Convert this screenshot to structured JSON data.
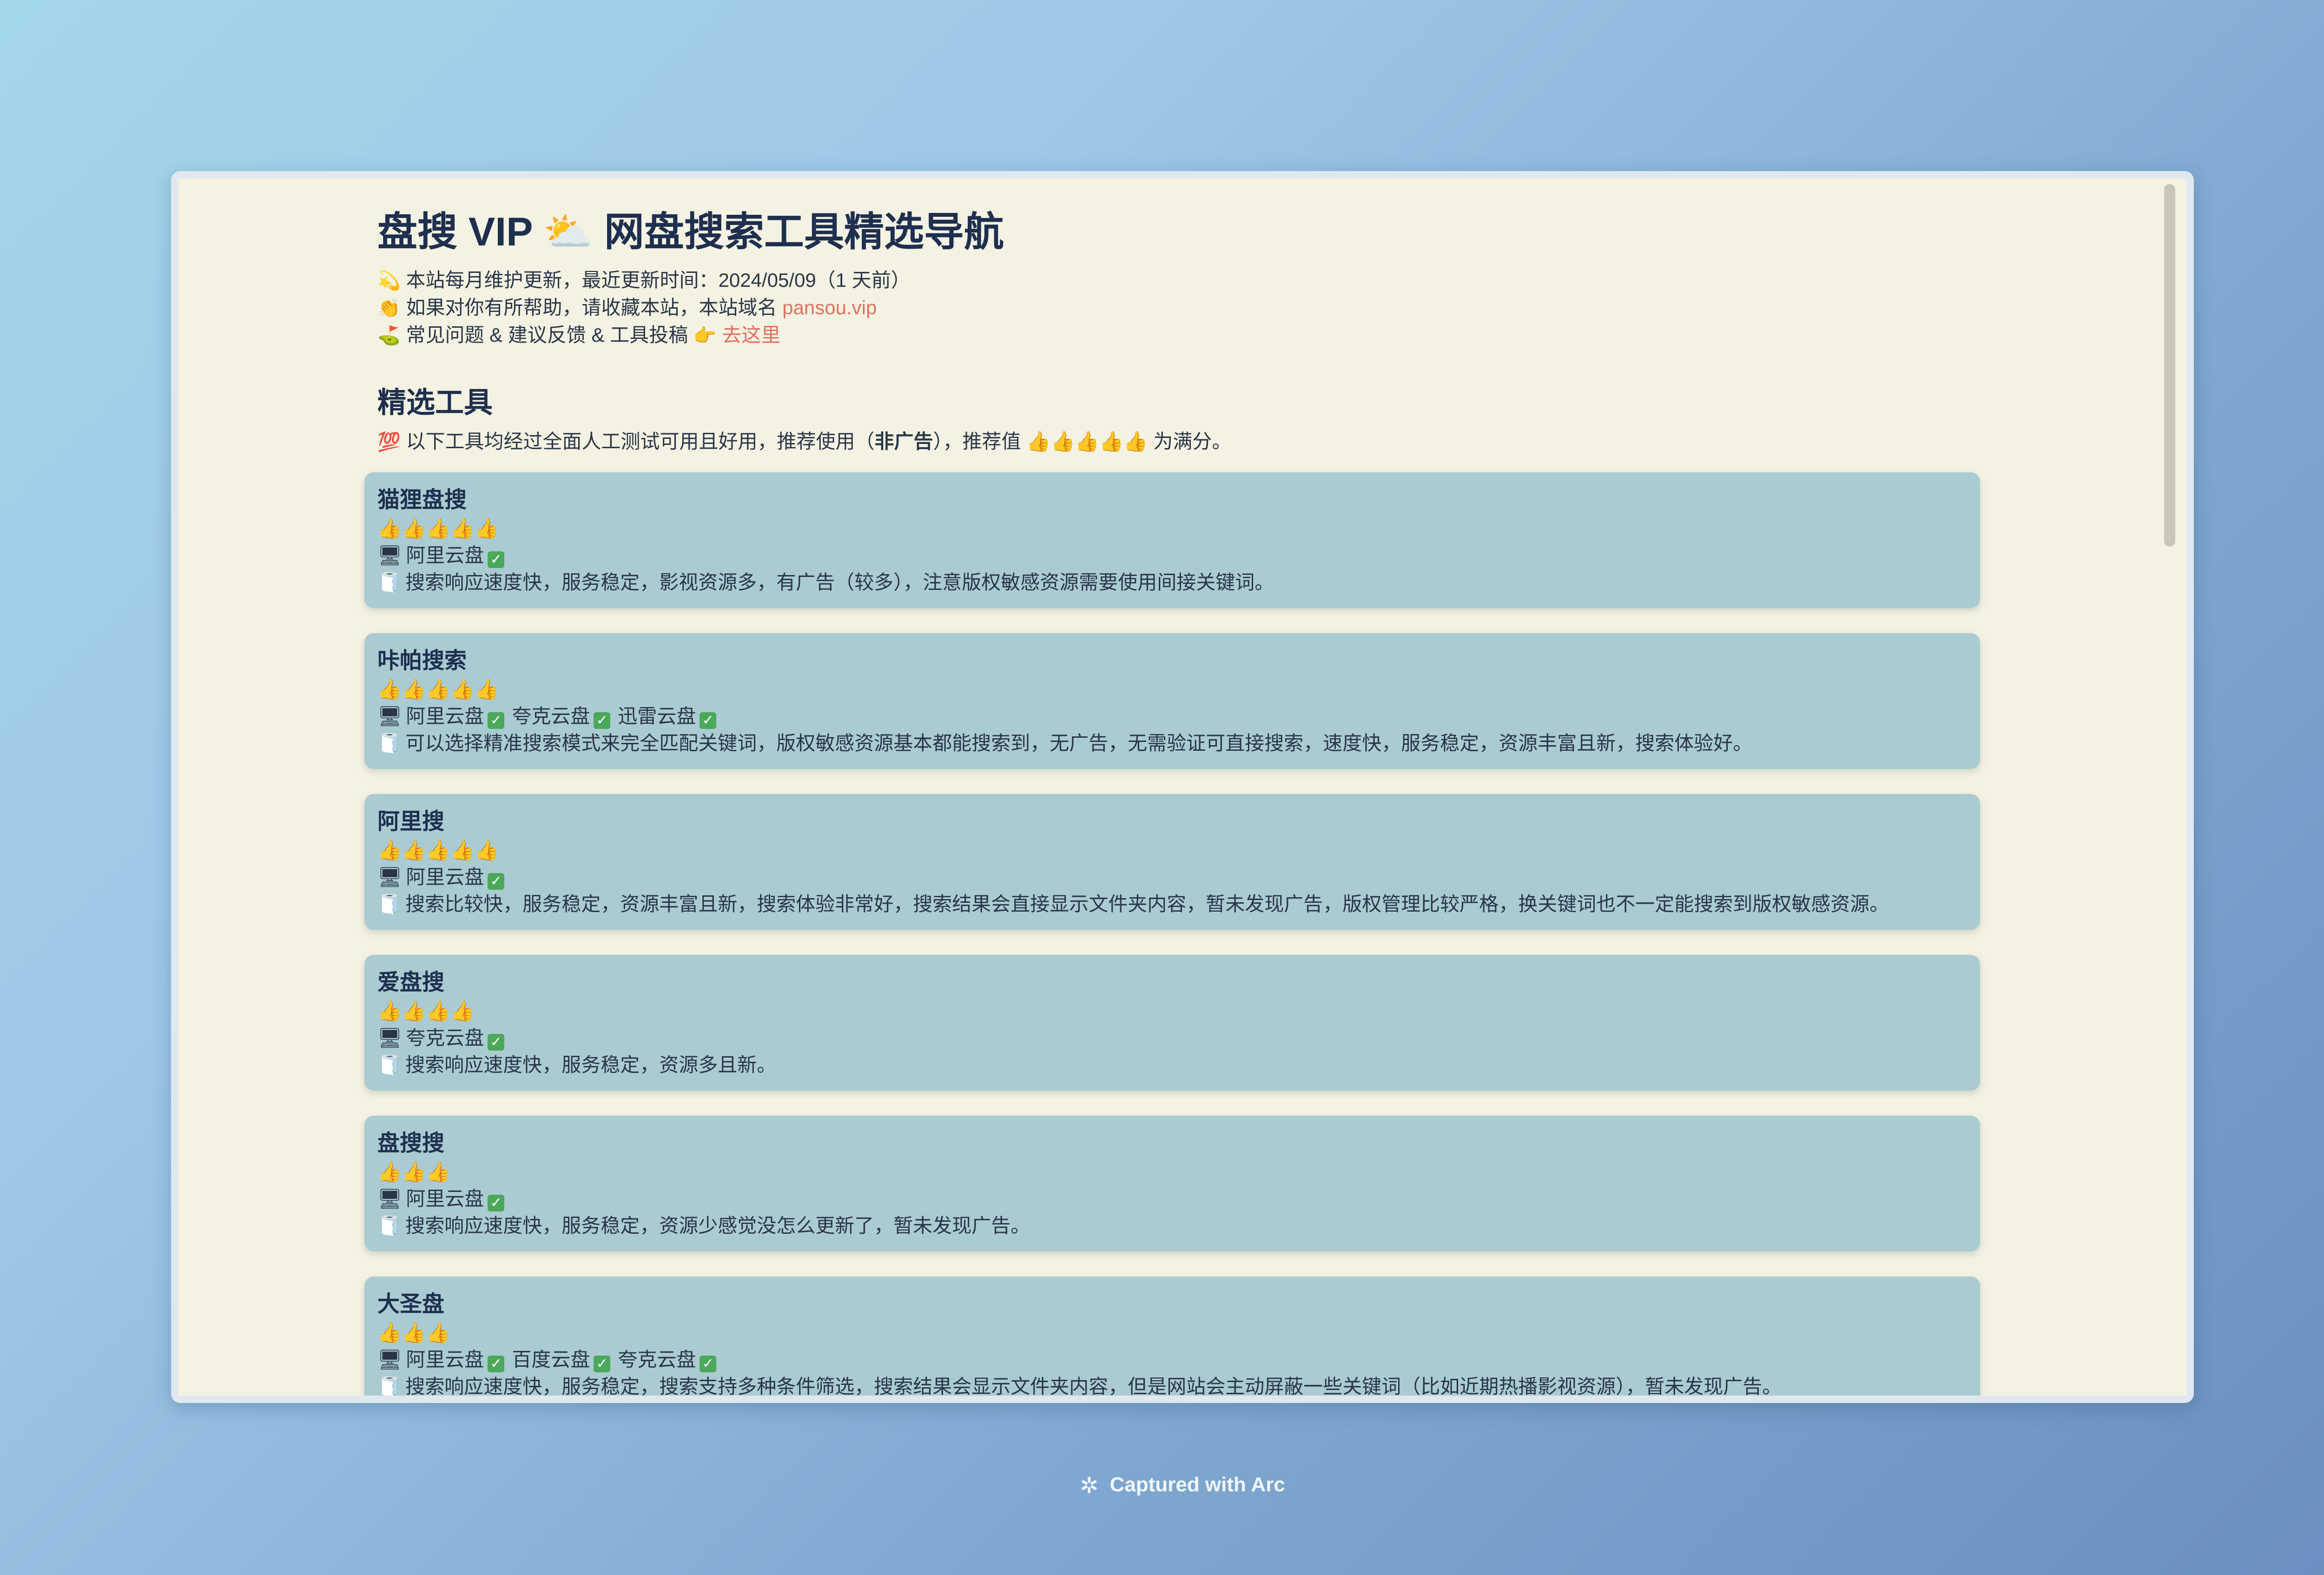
{
  "header": {
    "title": "盘搜 VIP ⛅ 网盘搜索工具精选导航",
    "line1_emoji": "💫",
    "line1": "本站每月维护更新，最近更新时间：2024/05/09（1 天前）",
    "line2_emoji": "👏",
    "line2": "如果对你有所帮助，请收藏本站，本站域名",
    "line2_link": "pansou.vip",
    "line3_emoji": "⛳",
    "line3": "常见问题 & 建议反馈 & 工具投稿",
    "line3_pointer": "👉",
    "line3_link": "去这里"
  },
  "section": {
    "title": "精选工具",
    "note_emoji": "💯",
    "note_pre": "以下工具均经过全面人工测试可用且好用，推荐使用（",
    "note_bold": "非广告",
    "note_post": "），推荐值 👍👍👍👍👍 为满分。"
  },
  "tools": [
    {
      "name": "猫狸盘搜",
      "rating": "👍👍👍👍👍",
      "drives": [
        "阿里云盘"
      ],
      "desc": "搜索响应速度快，服务稳定，影视资源多，有广告（较多），注意版权敏感资源需要使用间接关键词。"
    },
    {
      "name": "咔帕搜索",
      "rating": "👍👍👍👍👍",
      "drives": [
        "阿里云盘",
        "夸克云盘",
        "迅雷云盘"
      ],
      "desc": "可以选择精准搜索模式来完全匹配关键词，版权敏感资源基本都能搜索到，无广告，无需验证可直接搜索，速度快，服务稳定，资源丰富且新，搜索体验好。"
    },
    {
      "name": "阿里搜",
      "rating": "👍👍👍👍👍",
      "drives": [
        "阿里云盘"
      ],
      "desc": "搜索比较快，服务稳定，资源丰富且新，搜索体验非常好，搜索结果会直接显示文件夹内容，暂未发现广告，版权管理比较严格，换关键词也不一定能搜索到版权敏感资源。"
    },
    {
      "name": "爱盘搜",
      "rating": "👍👍👍👍",
      "drives": [
        "夸克云盘"
      ],
      "desc": "搜索响应速度快，服务稳定，资源多且新。"
    },
    {
      "name": "盘搜搜",
      "rating": "👍👍👍",
      "drives": [
        "阿里云盘"
      ],
      "desc": "搜索响应速度快，服务稳定，资源少感觉没怎么更新了，暂未发现广告。"
    },
    {
      "name": "大圣盘",
      "rating": "👍👍👍",
      "drives": [
        "阿里云盘",
        "百度云盘",
        "夸克云盘"
      ],
      "desc": "搜索响应速度快，服务稳定，搜索支持多种条件筛选，搜索结果会显示文件夹内容，但是网站会主动屏蔽一些关键词（比如近期热播影视资源），暂未发现广告。"
    }
  ],
  "icons": {
    "drive": "🖥",
    "desc": "🧻",
    "check": "✓"
  },
  "footer": {
    "text": "Captured with Arc"
  }
}
